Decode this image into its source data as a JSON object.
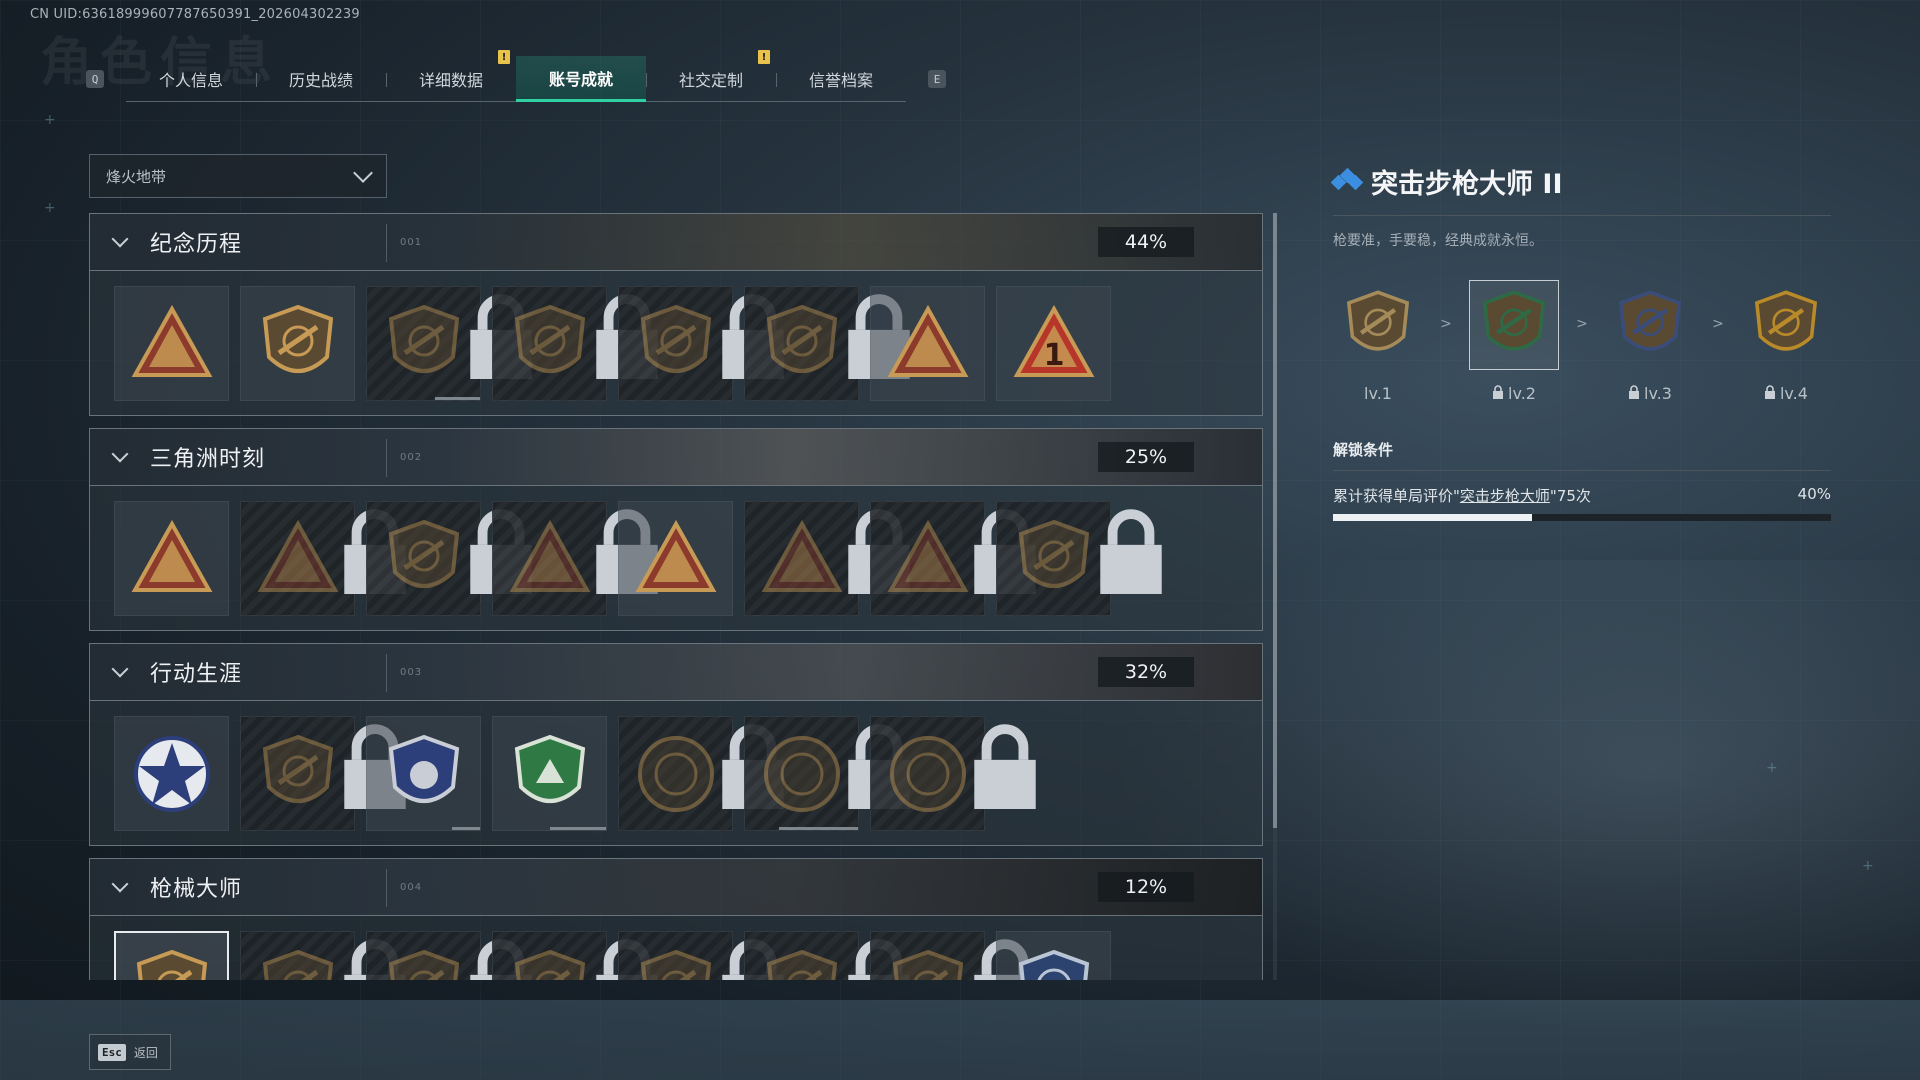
{
  "uid_text": "CN UID:63618999607787650391_202604302239",
  "bg_title": "角色信息",
  "tabs": {
    "prev_key": "Q",
    "next_key": "E",
    "items": [
      {
        "label": "个人信息",
        "active": false,
        "notify": false
      },
      {
        "label": "历史战绩",
        "active": false,
        "notify": false
      },
      {
        "label": "详细数据",
        "active": false,
        "notify": true
      },
      {
        "label": "账号成就",
        "active": true,
        "notify": false
      },
      {
        "label": "社交定制",
        "active": false,
        "notify": true
      },
      {
        "label": "信誉档案",
        "active": false,
        "notify": false
      }
    ],
    "notify_mark": "!"
  },
  "mode_select": {
    "value": "烽火地带"
  },
  "categories": [
    {
      "title": "纪念历程",
      "code": "001",
      "percent": "44%",
      "badges": [
        {
          "icon": "triangle-emblem-icon",
          "locked": false,
          "progress": 0
        },
        {
          "icon": "helicopter-badge-icon",
          "locked": false,
          "progress": 0
        },
        {
          "icon": "shield-chevron-icon",
          "locked": true,
          "progress": 0.4
        },
        {
          "icon": "robot-badge-icon",
          "locked": true,
          "progress": 0
        },
        {
          "icon": "hooded-figure-icon",
          "locked": true,
          "progress": 0
        },
        {
          "icon": "skull-swords-icon",
          "locked": true,
          "progress": 0
        },
        {
          "icon": "ship-triangle-icon",
          "locked": false,
          "progress": 0
        },
        {
          "icon": "number-one-triangle-icon",
          "locked": false,
          "progress": 0
        }
      ]
    },
    {
      "title": "三角洲时刻",
      "code": "002",
      "percent": "25%",
      "badges": [
        {
          "icon": "soldier-triangle-icon",
          "locked": false,
          "progress": 0
        },
        {
          "icon": "robot-triangle-icon",
          "locked": true,
          "progress": 0
        },
        {
          "icon": "kneeling-figure-icon",
          "locked": true,
          "progress": 0
        },
        {
          "icon": "gear-triangle-icon",
          "locked": true,
          "progress": 0
        },
        {
          "icon": "squad-triangle-icon",
          "locked": false,
          "progress": 0
        },
        {
          "icon": "group-triangle-icon",
          "locked": true,
          "progress": 0
        },
        {
          "icon": "dragon-triangle-icon",
          "locked": true,
          "progress": 0
        },
        {
          "icon": "cube-diamond-icon",
          "locked": true,
          "progress": 0
        }
      ]
    },
    {
      "title": "行动生涯",
      "code": "003",
      "percent": "32%",
      "badges": [
        {
          "icon": "star-medal-icon",
          "locked": false,
          "progress": 0
        },
        {
          "icon": "eagle-shield-icon",
          "locked": true,
          "progress": 0
        },
        {
          "icon": "police-shield-icon",
          "locked": false,
          "progress": 0.25
        },
        {
          "icon": "green-star-shield-icon",
          "locked": false,
          "progress": 0.5
        },
        {
          "icon": "planet-circle-icon",
          "locked": true,
          "progress": 0
        },
        {
          "icon": "skull-circle-icon",
          "locked": true,
          "progress": 0.7
        },
        {
          "icon": "eye-circle-icon",
          "locked": true,
          "progress": 0
        }
      ]
    },
    {
      "title": "枪械大师",
      "code": "004",
      "percent": "12%",
      "badges": [
        {
          "icon": "rifle-shield-icon",
          "locked": false,
          "selected": true,
          "progress": 0
        },
        {
          "icon": "rifle-shield-icon",
          "locked": true,
          "progress": 0
        },
        {
          "icon": "rifle-shield-icon",
          "locked": true,
          "progress": 0
        },
        {
          "icon": "rifle-shield-icon",
          "locked": true,
          "progress": 0
        },
        {
          "icon": "rifle-shield-icon",
          "locked": true,
          "progress": 0
        },
        {
          "icon": "rifle-shield-icon",
          "locked": true,
          "progress": 0
        },
        {
          "icon": "rifle-shield-icon",
          "locked": true,
          "progress": 0
        },
        {
          "icon": "rifle-shield-blue-icon",
          "locked": false,
          "progress": 0
        }
      ]
    }
  ],
  "detail": {
    "title": "突击步枪大师 II",
    "description": "枪要准，手要稳，经典成就永恒。",
    "levels": [
      {
        "label": "lv.1",
        "locked": false,
        "current": false,
        "color": "#a58a5a"
      },
      {
        "label": "lv.2",
        "locked": true,
        "current": true,
        "color": "#2e6a45"
      },
      {
        "label": "lv.3",
        "locked": true,
        "current": false,
        "color": "#3a4d7a"
      },
      {
        "label": "lv.4",
        "locked": true,
        "current": false,
        "color": "#b88a2a"
      }
    ],
    "level_arrow": ">",
    "unlock_title": "解锁条件",
    "unlock_prefix": "累计获得单局评价\"",
    "unlock_link": "突击步枪大师",
    "unlock_suffix": "\"75次",
    "unlock_percent": "40%",
    "unlock_progress": 0.4
  },
  "footer": {
    "esc_key": "Esc",
    "back_label": "返回"
  }
}
